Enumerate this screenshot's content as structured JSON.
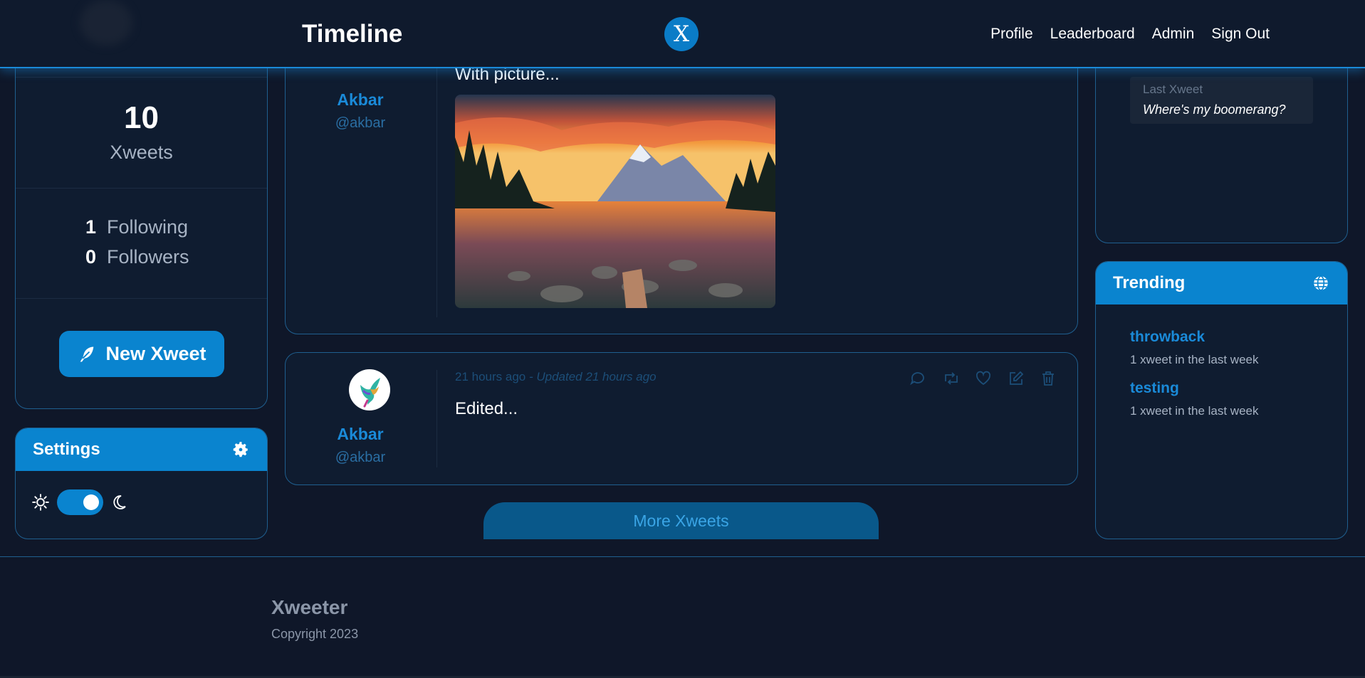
{
  "header": {
    "title": "Timeline",
    "logo_letter": "X",
    "nav": [
      "Profile",
      "Leaderboard",
      "Admin",
      "Sign Out"
    ]
  },
  "profile": {
    "xweets_count": "10",
    "xweets_label": "Xweets",
    "following_count": "1",
    "following_label": "Following",
    "followers_count": "0",
    "followers_label": "Followers",
    "new_xweet_label": "New Xweet"
  },
  "settings": {
    "title": "Settings",
    "dark_mode_on": true
  },
  "xweets": [
    {
      "author": "Akbar",
      "handle": "@akbar",
      "text": "With picture..."
    },
    {
      "author": "Akbar",
      "handle": "@akbar",
      "time": "21 hours ago",
      "updated": "- Updated 21 hours ago",
      "text": "Edited..."
    }
  ],
  "more_label": "More Xweets",
  "recent": {
    "last_label": "Last Xweet",
    "last_text": "Where's my boomerang?"
  },
  "trending": {
    "title": "Trending",
    "items": [
      {
        "tag": "throwback",
        "desc": "1 xweet in the last week"
      },
      {
        "tag": "testing",
        "desc": "1 xweet in the last week"
      }
    ]
  },
  "footer": {
    "brand": "Xweeter",
    "copyright": "Copyright 2023"
  },
  "colors": {
    "background": "#0f1729",
    "accent": "#0a84cf",
    "link": "#1a8ad8",
    "card_border": "#1f5f8f"
  }
}
